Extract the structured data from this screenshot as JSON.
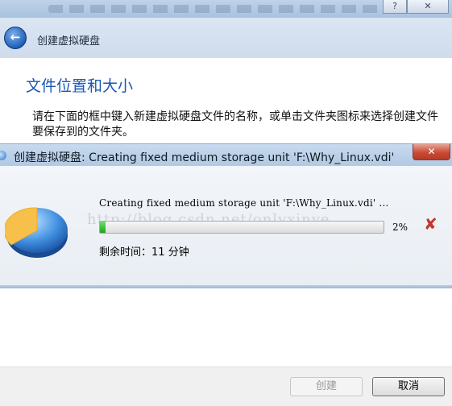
{
  "wizard": {
    "help_label": "?",
    "close_label": "✕",
    "back_icon": "back-arrow-icon",
    "title": "创建虚拟硬盘",
    "section_title": "文件位置和大小",
    "description": "请在下面的框中键入新建虚拟硬盘文件的名称，或单击文件夹图标来选择创建文件要保存到的文件夹。",
    "buttons": {
      "create": "创建",
      "cancel": "取消"
    }
  },
  "progress_dialog": {
    "title": "创建虚拟硬盘: Creating fixed medium storage unit 'F:\\Why_Linux.vdi'",
    "close_label": "✕",
    "message": "Creating fixed medium storage unit 'F:\\Why_Linux.vdi' ...",
    "percent_label": "2%",
    "progress_fraction": 0.02,
    "remaining_label": "剩余时间：",
    "remaining_value": "11 分钟",
    "cancel_icon": "cancel-x-icon",
    "watermark": "http://blog.csdn.net/onlyxinye"
  },
  "colors": {
    "accent_blue": "#1a57b5",
    "progress_green": "#1fa11f",
    "cancel_red": "#c0392b"
  }
}
